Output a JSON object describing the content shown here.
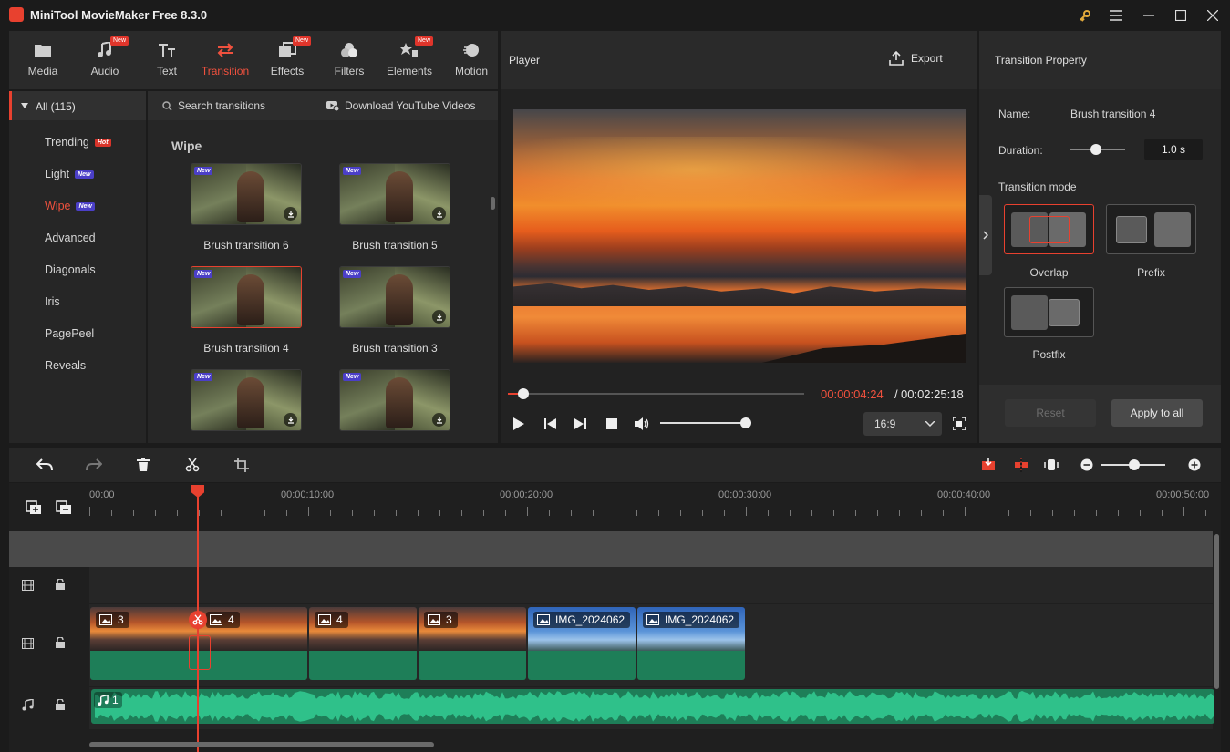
{
  "app": {
    "title": "MiniTool MovieMaker Free 8.3.0",
    "accent_color": "#e8412f"
  },
  "media_tabs": [
    {
      "label": "Media",
      "icon": "folder-icon",
      "new": false
    },
    {
      "label": "Audio",
      "icon": "music-note-icon",
      "new": true
    },
    {
      "label": "Text",
      "icon": "text-icon",
      "new": false
    },
    {
      "label": "Transition",
      "icon": "swap-arrows-icon",
      "new": false,
      "active": true
    },
    {
      "label": "Effects",
      "icon": "effects-icon",
      "new": true
    },
    {
      "label": "Filters",
      "icon": "filters-icon",
      "new": false
    },
    {
      "label": "Elements",
      "icon": "elements-icon",
      "new": true
    },
    {
      "label": "Motion",
      "icon": "motion-icon",
      "new": false
    }
  ],
  "badges": {
    "new": "New",
    "hot": "Hot"
  },
  "categories": {
    "all_label": "All (115)",
    "items": [
      {
        "label": "Trending",
        "badge": "Hot"
      },
      {
        "label": "Light",
        "badge": "New"
      },
      {
        "label": "Wipe",
        "badge": "New",
        "active": true
      },
      {
        "label": "Advanced"
      },
      {
        "label": "Diagonals"
      },
      {
        "label": "Iris"
      },
      {
        "label": "PagePeel"
      },
      {
        "label": "Reveals"
      }
    ]
  },
  "library": {
    "search_label": "Search transitions",
    "download_label": "Download YouTube Videos",
    "section_title": "Wipe",
    "cards": [
      {
        "label": "Brush transition 6"
      },
      {
        "label": "Brush transition 5"
      },
      {
        "label": "Brush transition 4",
        "selected": true
      },
      {
        "label": "Brush transition 3"
      },
      {
        "label": ""
      },
      {
        "label": ""
      }
    ]
  },
  "player": {
    "title": "Player",
    "export_label": "Export",
    "current_time": "00:00:04:24",
    "separator": "/",
    "total_time": "00:02:25:18",
    "aspect_ratio": "16:9",
    "progress_fraction": 0.03,
    "volume_fraction": 0.9
  },
  "properties": {
    "title": "Transition Property",
    "name_label": "Name:",
    "name_value": "Brush transition 4",
    "duration_label": "Duration:",
    "duration_value": "1.0 s",
    "mode_label": "Transition mode",
    "modes": [
      {
        "label": "Overlap",
        "selected": true
      },
      {
        "label": "Prefix"
      },
      {
        "label": "Postfix"
      }
    ],
    "reset_label": "Reset",
    "apply_label": "Apply to all"
  },
  "timeline": {
    "ruler_labels": [
      "00:00",
      "00:00:10:00",
      "00:00:20:00",
      "00:00:30:00",
      "00:00:40:00",
      "00:00:50:00"
    ],
    "clips": [
      {
        "label": "3",
        "style": "sunset"
      },
      {
        "label": "4",
        "style": "sunset"
      },
      {
        "label": "4",
        "style": "sunset"
      },
      {
        "label": "3",
        "style": "sunset"
      },
      {
        "label": "IMG_2024062",
        "style": "sky"
      },
      {
        "label": "IMG_2024062",
        "style": "sky"
      }
    ],
    "audio_label": "1"
  }
}
